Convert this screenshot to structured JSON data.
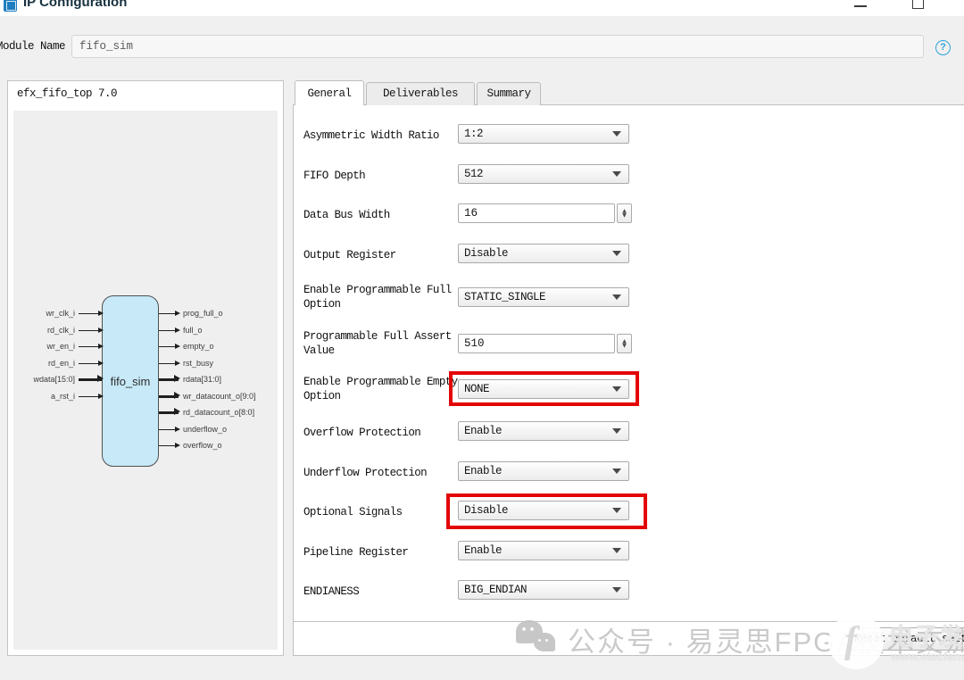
{
  "window": {
    "title": "IP Configuration",
    "controls": {
      "minimize": "minimize",
      "maximize": "maximize"
    }
  },
  "header": {
    "module_name_label": "Module Name",
    "module_name_value": "fifo_sim",
    "help_glyph": "?"
  },
  "left_panel": {
    "title": "efx_fifo_top 7.0",
    "block_name": "fifo_sim",
    "input_ports": [
      {
        "name": "wr_clk_i",
        "bus": false
      },
      {
        "name": "rd_clk_i",
        "bus": false
      },
      {
        "name": "wr_en_i",
        "bus": false
      },
      {
        "name": "rd_en_i",
        "bus": false
      },
      {
        "name": "wdata[15:0]",
        "bus": true
      },
      {
        "name": "a_rst_i",
        "bus": false
      }
    ],
    "output_ports": [
      {
        "name": "prog_full_o",
        "bus": false
      },
      {
        "name": "full_o",
        "bus": false
      },
      {
        "name": "empty_o",
        "bus": false
      },
      {
        "name": "rst_busy",
        "bus": false
      },
      {
        "name": "rdata[31:0]",
        "bus": true
      },
      {
        "name": "wr_datacount_o[9:0]",
        "bus": true
      },
      {
        "name": "rd_datacount_o[8:0]",
        "bus": true
      },
      {
        "name": "underflow_o",
        "bus": false
      },
      {
        "name": "overflow_o",
        "bus": false
      }
    ]
  },
  "tabs": [
    {
      "label": "General",
      "active": true
    },
    {
      "label": "Deliverables",
      "active": false
    },
    {
      "label": "Summary",
      "active": false
    }
  ],
  "form": {
    "rows": [
      {
        "label": "Asymmetric Width Ratio",
        "value": "1:2",
        "control": "dropdown",
        "highlighted": false
      },
      {
        "label": "FIFO Depth",
        "value": "512",
        "control": "dropdown",
        "highlighted": false
      },
      {
        "label": "Data Bus Width",
        "value": "16",
        "control": "spinner",
        "highlighted": false
      },
      {
        "label": "Output Register",
        "value": "Disable",
        "control": "dropdown",
        "highlighted": false
      },
      {
        "label": "Enable Programmable Full Option",
        "value": "STATIC_SINGLE",
        "control": "dropdown",
        "highlighted": false
      },
      {
        "label": "Programmable Full Assert Value",
        "value": "510",
        "control": "spinner",
        "highlighted": false
      },
      {
        "label": "Enable Programmable Empty Option",
        "value": "NONE",
        "control": "dropdown",
        "highlighted": true
      },
      {
        "label": "Overflow Protection",
        "value": "Enable",
        "control": "dropdown",
        "highlighted": false
      },
      {
        "label": "Underflow Protection",
        "value": "Enable",
        "control": "dropdown",
        "highlighted": false
      },
      {
        "label": "Optional Signals",
        "value": "Disable",
        "control": "dropdown",
        "highlighted": true
      },
      {
        "label": "Pipeline Register",
        "value": "Enable",
        "control": "dropdown",
        "highlighted": false
      },
      {
        "label": "ENDIANESS",
        "value": "BIG_ENDIAN",
        "control": "dropdown",
        "highlighted": false
      }
    ]
  },
  "footer": {
    "reset_button_label": "Reset default settings"
  },
  "watermarks": {
    "wechat_text": "公众号 · 易灵思FPGA技术交流",
    "elecfans_logo_glyph": "f",
    "elecfans_name": "电子发烧友",
    "elecfans_url": "www.elecfans.com"
  },
  "icons": {
    "spinner_up_glyph": "▲",
    "spinner_down_glyph": "▼"
  },
  "colors": {
    "highlight_red": "#e30505",
    "block_fill": "#c7e9f8",
    "help_blue": "#2ba3d8",
    "app_icon_blue": "#1f7ec2",
    "background": "#f0f0f0"
  }
}
